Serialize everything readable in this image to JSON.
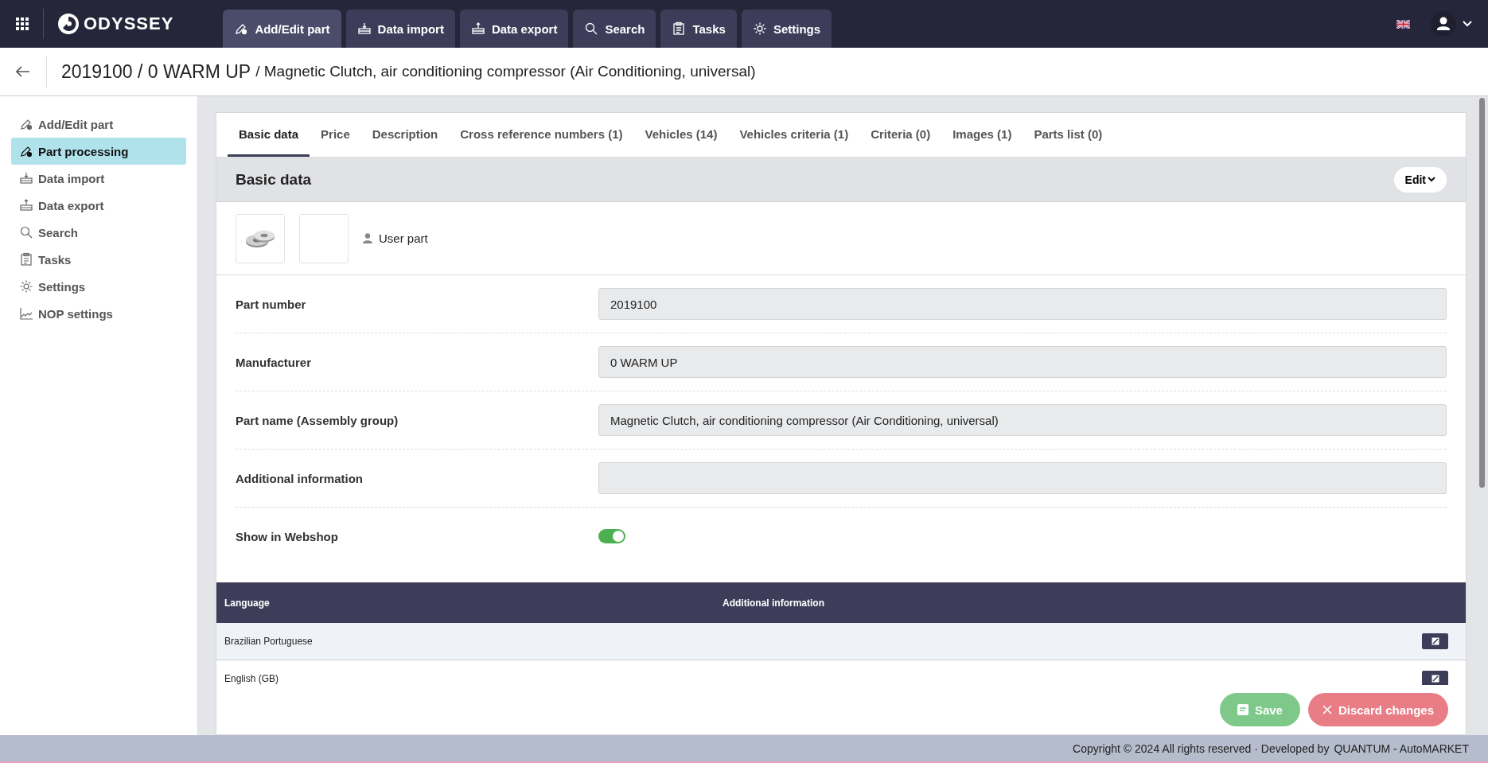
{
  "app": {
    "logo": "ODYSSEY"
  },
  "nav_tabs": [
    {
      "label": "Add/Edit part",
      "selected": true
    },
    {
      "label": "Data import",
      "selected": false
    },
    {
      "label": "Data export",
      "selected": false
    },
    {
      "label": "Search",
      "selected": false
    },
    {
      "label": "Tasks",
      "selected": false
    },
    {
      "label": "Settings",
      "selected": false
    }
  ],
  "page_title": {
    "main": "2019100 / 0 WARM UP",
    "sub": "/ Magnetic Clutch, air conditioning compressor (Air Conditioning, universal)"
  },
  "sidebar": {
    "items": [
      {
        "label": "Add/Edit part",
        "selected": false
      },
      {
        "label": "Part processing",
        "selected": true
      },
      {
        "label": "Data import",
        "selected": false
      },
      {
        "label": "Data export",
        "selected": false
      },
      {
        "label": "Search",
        "selected": false
      },
      {
        "label": "Tasks",
        "selected": false
      },
      {
        "label": "Settings",
        "selected": false
      },
      {
        "label": "NOP settings",
        "selected": false
      }
    ]
  },
  "tabs": [
    {
      "label": "Basic data",
      "selected": true
    },
    {
      "label": "Price",
      "selected": false
    },
    {
      "label": "Description",
      "selected": false
    },
    {
      "label": "Cross reference numbers (1)",
      "selected": false
    },
    {
      "label": "Vehicles (14)",
      "selected": false
    },
    {
      "label": "Vehicles criteria (1)",
      "selected": false
    },
    {
      "label": "Criteria (0)",
      "selected": false
    },
    {
      "label": "Images (1)",
      "selected": false
    },
    {
      "label": "Parts list (0)",
      "selected": false
    }
  ],
  "section": {
    "title": "Basic data",
    "edit_button": "Edit",
    "images": [
      {
        "kind": "picture"
      },
      {
        "kind": "empty"
      }
    ],
    "owner": "User part"
  },
  "fields": [
    {
      "kind": "text",
      "label": "Part number",
      "value": "2019100"
    },
    {
      "kind": "text",
      "label": "Manufacturer",
      "value": "0 WARM UP"
    },
    {
      "kind": "text",
      "label": "Part name (Assembly group)",
      "value": "Magnetic Clutch, air conditioning compressor (Air Conditioning, universal)"
    },
    {
      "kind": "text",
      "label": "Additional information"
    },
    {
      "kind": "toggle",
      "label": "Show in Webshop",
      "on": true
    }
  ],
  "table": {
    "columns": [
      "Language",
      "Additional information"
    ],
    "rows": [
      {
        "language": "Brazilian Portuguese"
      },
      {
        "language": "English (GB)"
      }
    ]
  },
  "actions": {
    "save": "Save",
    "discard": "Discard changes"
  },
  "footer": {
    "text": "Copyright © 2024 All rights reserved · Developed by",
    "link": "QUANTUM - AutoMARKET"
  }
}
